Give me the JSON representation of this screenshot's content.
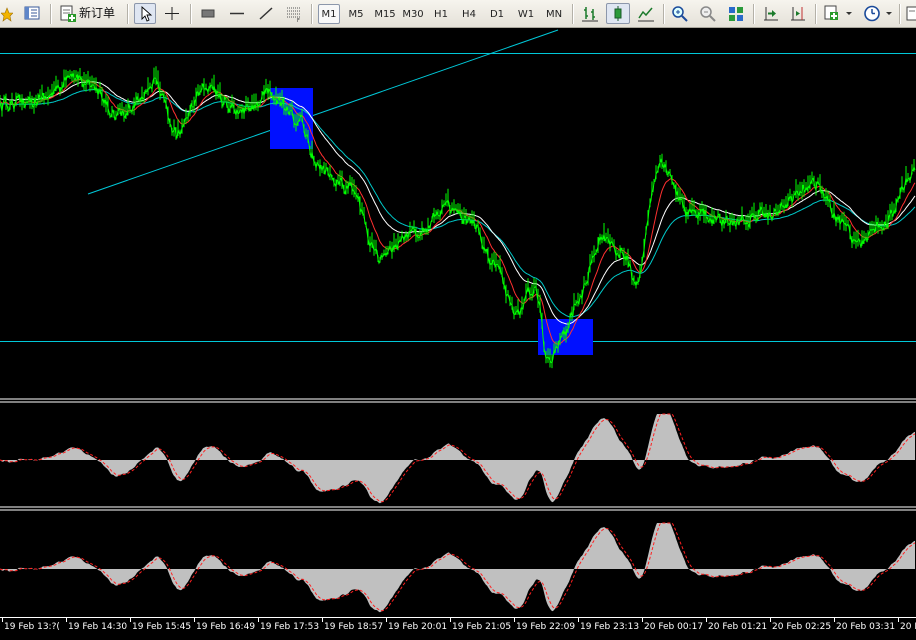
{
  "toolbar": {
    "new_order_label": "新订单",
    "timeframes": [
      "M1",
      "M5",
      "M15",
      "M30",
      "H1",
      "H4",
      "D1",
      "W1",
      "MN"
    ],
    "active_timeframe": "M1"
  },
  "colors": {
    "background": "#000000",
    "price": "#00ff00",
    "ma_fast": "#ff3030",
    "ma_mid": "#ffffff",
    "ma_slow": "#00c8c8",
    "trendline": "#00c8d8",
    "highlight": "#0010ff",
    "histogram": "#c0c0c0",
    "signal": "#ff2020"
  },
  "time_axis": {
    "labels": [
      "19 Feb 13:?(",
      "19 Feb 14:30",
      "19 Feb 15:45",
      "19 Feb 16:49",
      "19 Feb 17:53",
      "19 Feb 18:57",
      "19 Feb 20:01",
      "19 Feb 21:05",
      "19 Feb 22:09",
      "19 Feb 23:13",
      "20 Feb 00:17",
      "20 Feb 01:21",
      "20 Feb 02:25",
      "20 Feb 03:31",
      "20 Fe"
    ]
  }
}
